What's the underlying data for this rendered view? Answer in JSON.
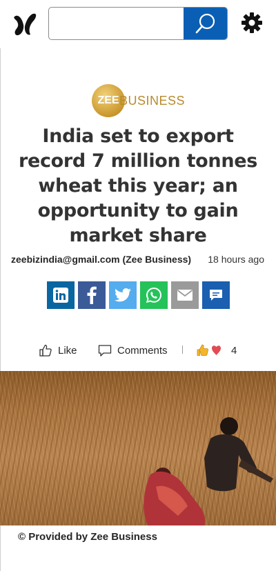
{
  "header": {
    "logo_icon": "msn-butterfly-icon",
    "search": {
      "placeholder": "",
      "value": "",
      "button_icon": "search-icon"
    },
    "settings_icon": "gear-icon",
    "accent_color": "#0a5fb4"
  },
  "publisher": {
    "logo_mark": "ZEE",
    "logo_text": "BUSINESS"
  },
  "article": {
    "headline": "India set to export record 7 million tonnes wheat this year; an opportunity to gain market share",
    "author": "zeebizindia@gmail.com (Zee Business)",
    "published": "18 hours ago"
  },
  "share_buttons": [
    {
      "icon": "linkedin-icon",
      "color": "#0a66a0"
    },
    {
      "icon": "facebook-icon",
      "color": "#3b5a98"
    },
    {
      "icon": "twitter-icon",
      "color": "#55acee"
    },
    {
      "icon": "whatsapp-icon",
      "color": "#25c25a"
    },
    {
      "icon": "email-icon",
      "color": "#9a9a9a"
    },
    {
      "icon": "comment-icon",
      "color": "#1a5fb0"
    }
  ],
  "actions": {
    "like_label": "Like",
    "comments_label": "Comments",
    "reaction_count": "4"
  },
  "image": {
    "caption": "© Provided by Zee Business"
  }
}
